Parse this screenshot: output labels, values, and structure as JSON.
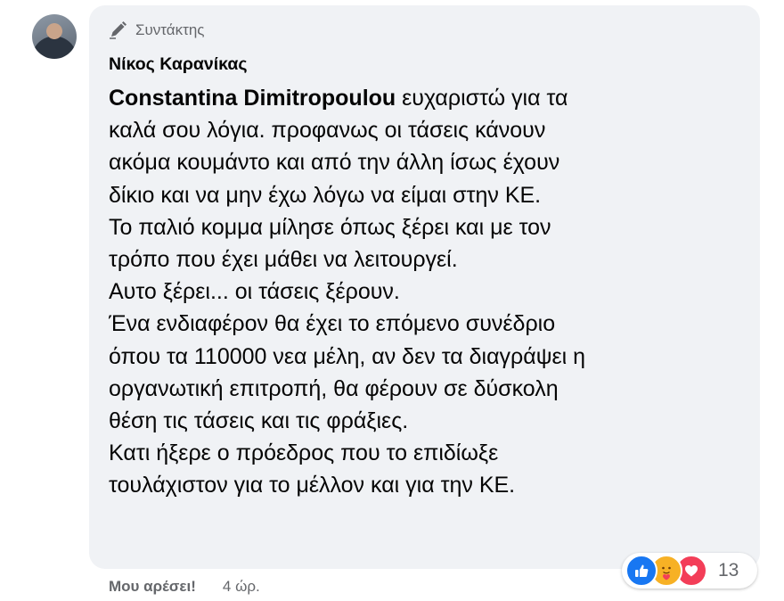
{
  "comment": {
    "badge_label": "Συντάκτης",
    "author_name": "Νίκος Καρανίκας",
    "mention": "Constantina Dimitropoulou",
    "first_line_rest": " ευχαριστώ για τα",
    "lines": [
      "καλά σου λόγια. προφανως οι τάσεις κάνουν",
      "ακόμα κουμάντο και από την άλλη ίσως έχουν",
      "δίκιο και να μην έχω λόγω να είμαι στην ΚΕ.",
      "Το παλιό κομμα μίλησε όπως ξέρει και με τον",
      "τρόπο που έχει μάθει να λειτουργεί.",
      "Αυτο ξέρει... οι τάσεις ξέρουν.",
      "Ένα ενδιαφέρον θα έχει το επόμενο συνέδριο",
      "όπου τα 110000 νεα μέλη, αν δεν τα διαγράψει η",
      "οργανωτική επιτροπή, θα φέρουν σε δύσκολη",
      "θέση τις τάσεις και τις φράξιες.",
      "Κατι ήξερε ο πρόεδρος που το επιδίωξε",
      "τουλάχιστον για το μέλλον και για την ΚΕ."
    ],
    "reactions": {
      "types": [
        "like-icon",
        "care-icon",
        "love-icon"
      ],
      "count": "13"
    },
    "footer": {
      "like_label": "Μου αρέσει!",
      "timestamp": "4 ώρ."
    }
  },
  "colors": {
    "bubble_bg": "#f0f2f5",
    "secondary_text": "#65676b",
    "like_blue": "#1877f2",
    "love_red": "#f33e58",
    "care_yellow": "#f7b125"
  }
}
